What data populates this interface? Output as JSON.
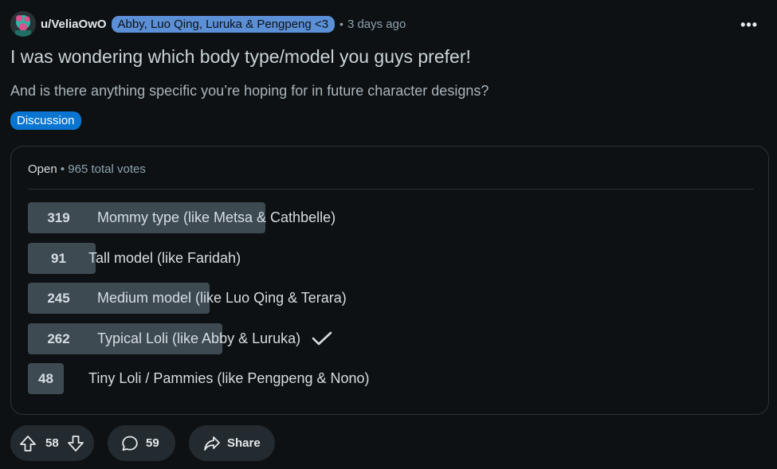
{
  "post": {
    "username": "u/VeliaOwO",
    "flair": "Abby, Luo Qing, Luruka & Pengpeng <3",
    "separator": "•",
    "age": "3 days ago",
    "more_label": "•••",
    "title": "I was wondering which body type/model you guys prefer!",
    "body": "And is there anything specific you’re hoping for in future character designs?",
    "tag": "Discussion"
  },
  "poll": {
    "status": "Open",
    "total_votes_text": "• 965 total votes",
    "total_votes": 965,
    "options": [
      {
        "count": "319",
        "votes": 319,
        "label": "Mommy type (like Metsa & Cathbelle)",
        "selected": false
      },
      {
        "count": "91",
        "votes": 91,
        "label": "Tall model (like Faridah)",
        "selected": false
      },
      {
        "count": "245",
        "votes": 245,
        "label": "Medium model (like Luo Qing & Terara)",
        "selected": false
      },
      {
        "count": "262",
        "votes": 262,
        "label": "Typical Loli (like Abby & Luruka)",
        "selected": true
      },
      {
        "count": "48",
        "votes": 48,
        "label": "Tiny Loli / Pammies (like Pengpeng & Nono)",
        "selected": false
      }
    ]
  },
  "actions": {
    "upvotes": "58",
    "comments": "59",
    "share_label": "Share"
  },
  "colors": {
    "background": "#0e1113",
    "flair": "#5b8fd6",
    "tag": "#0a75d1",
    "bar": "#3e4a52",
    "pill": "#232b30"
  }
}
